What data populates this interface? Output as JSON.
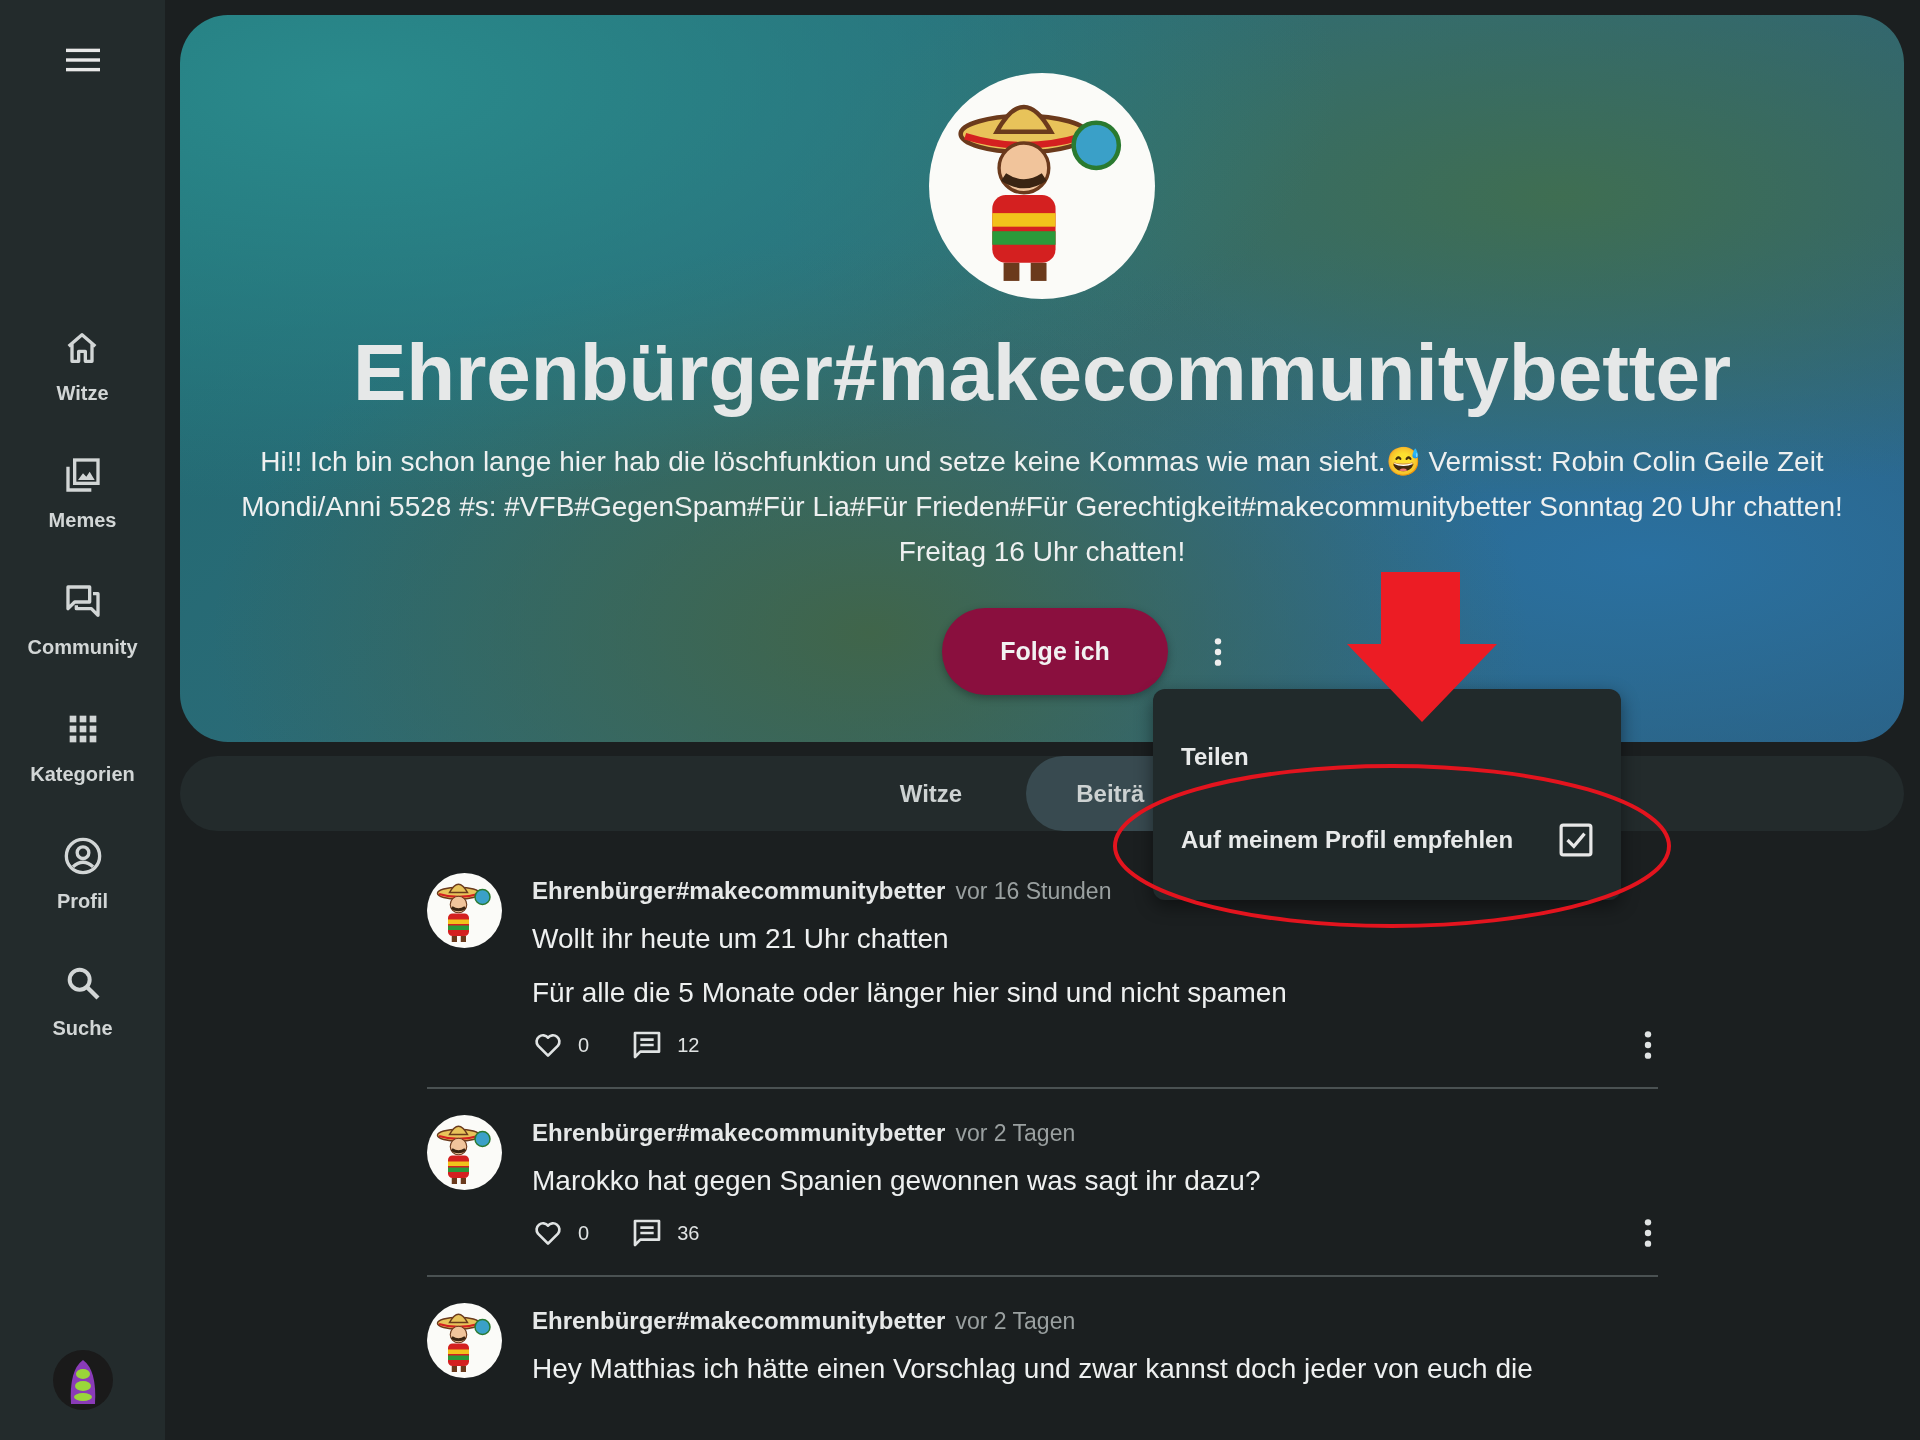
{
  "sidebar": {
    "items": [
      {
        "label": "Witze",
        "kind": "home"
      },
      {
        "label": "Memes",
        "kind": "images"
      },
      {
        "label": "Community",
        "kind": "forum"
      },
      {
        "label": "Kategorien",
        "kind": "grid"
      },
      {
        "label": "Profil",
        "kind": "account"
      },
      {
        "label": "Suche",
        "kind": "search"
      }
    ]
  },
  "profile": {
    "name": "Ehrenbürger#makecommunitybetter",
    "bio": "Hi!! Ich bin schon lange hier hab die löschfunktion und setze keine Kommas wie man sieht.😅 Vermisst: Robin Colin Geile Zeit Mondi/Anni 5528 #s: #VFB#GegenSpam#Für Lia#Für Frieden#Für Gerechtigkeit#makecommunitybetter Sonntag 20 Uhr chatten! Freitag 16 Uhr chatten!",
    "follow_button": "Folge ich"
  },
  "tabs": [
    {
      "label": "Witze",
      "selected": false
    },
    {
      "label": "Beiträ",
      "selected": true
    }
  ],
  "menu": {
    "items": [
      {
        "label": "Teilen",
        "kind": "action"
      },
      {
        "label": "Auf meinem Profil empfehlen",
        "kind": "checkbox",
        "checked": true
      }
    ]
  },
  "posts": [
    {
      "author": "Ehrenbürger#makecommunitybetter",
      "time": "vor 16 Stunden",
      "title": "Wollt ihr heute um 21 Uhr chatten",
      "body": "Für alle die 5 Monate oder länger hier sind und nicht spamen",
      "likes": "0",
      "comments": "12",
      "liked": false
    },
    {
      "author": "Ehrenbürger#makecommunitybetter",
      "time": "vor 2 Tagen",
      "title": "Marokko hat gegen Spanien gewonnen was sagt ihr dazu?",
      "likes": "0",
      "comments": "36",
      "liked": false
    },
    {
      "author": "Ehrenbürger#makecommunitybetter",
      "time": "vor 2 Tagen",
      "title": "Hey Matthias ich hätte einen Vorschlag und zwar kannst doch jeder von euch die"
    }
  ]
}
